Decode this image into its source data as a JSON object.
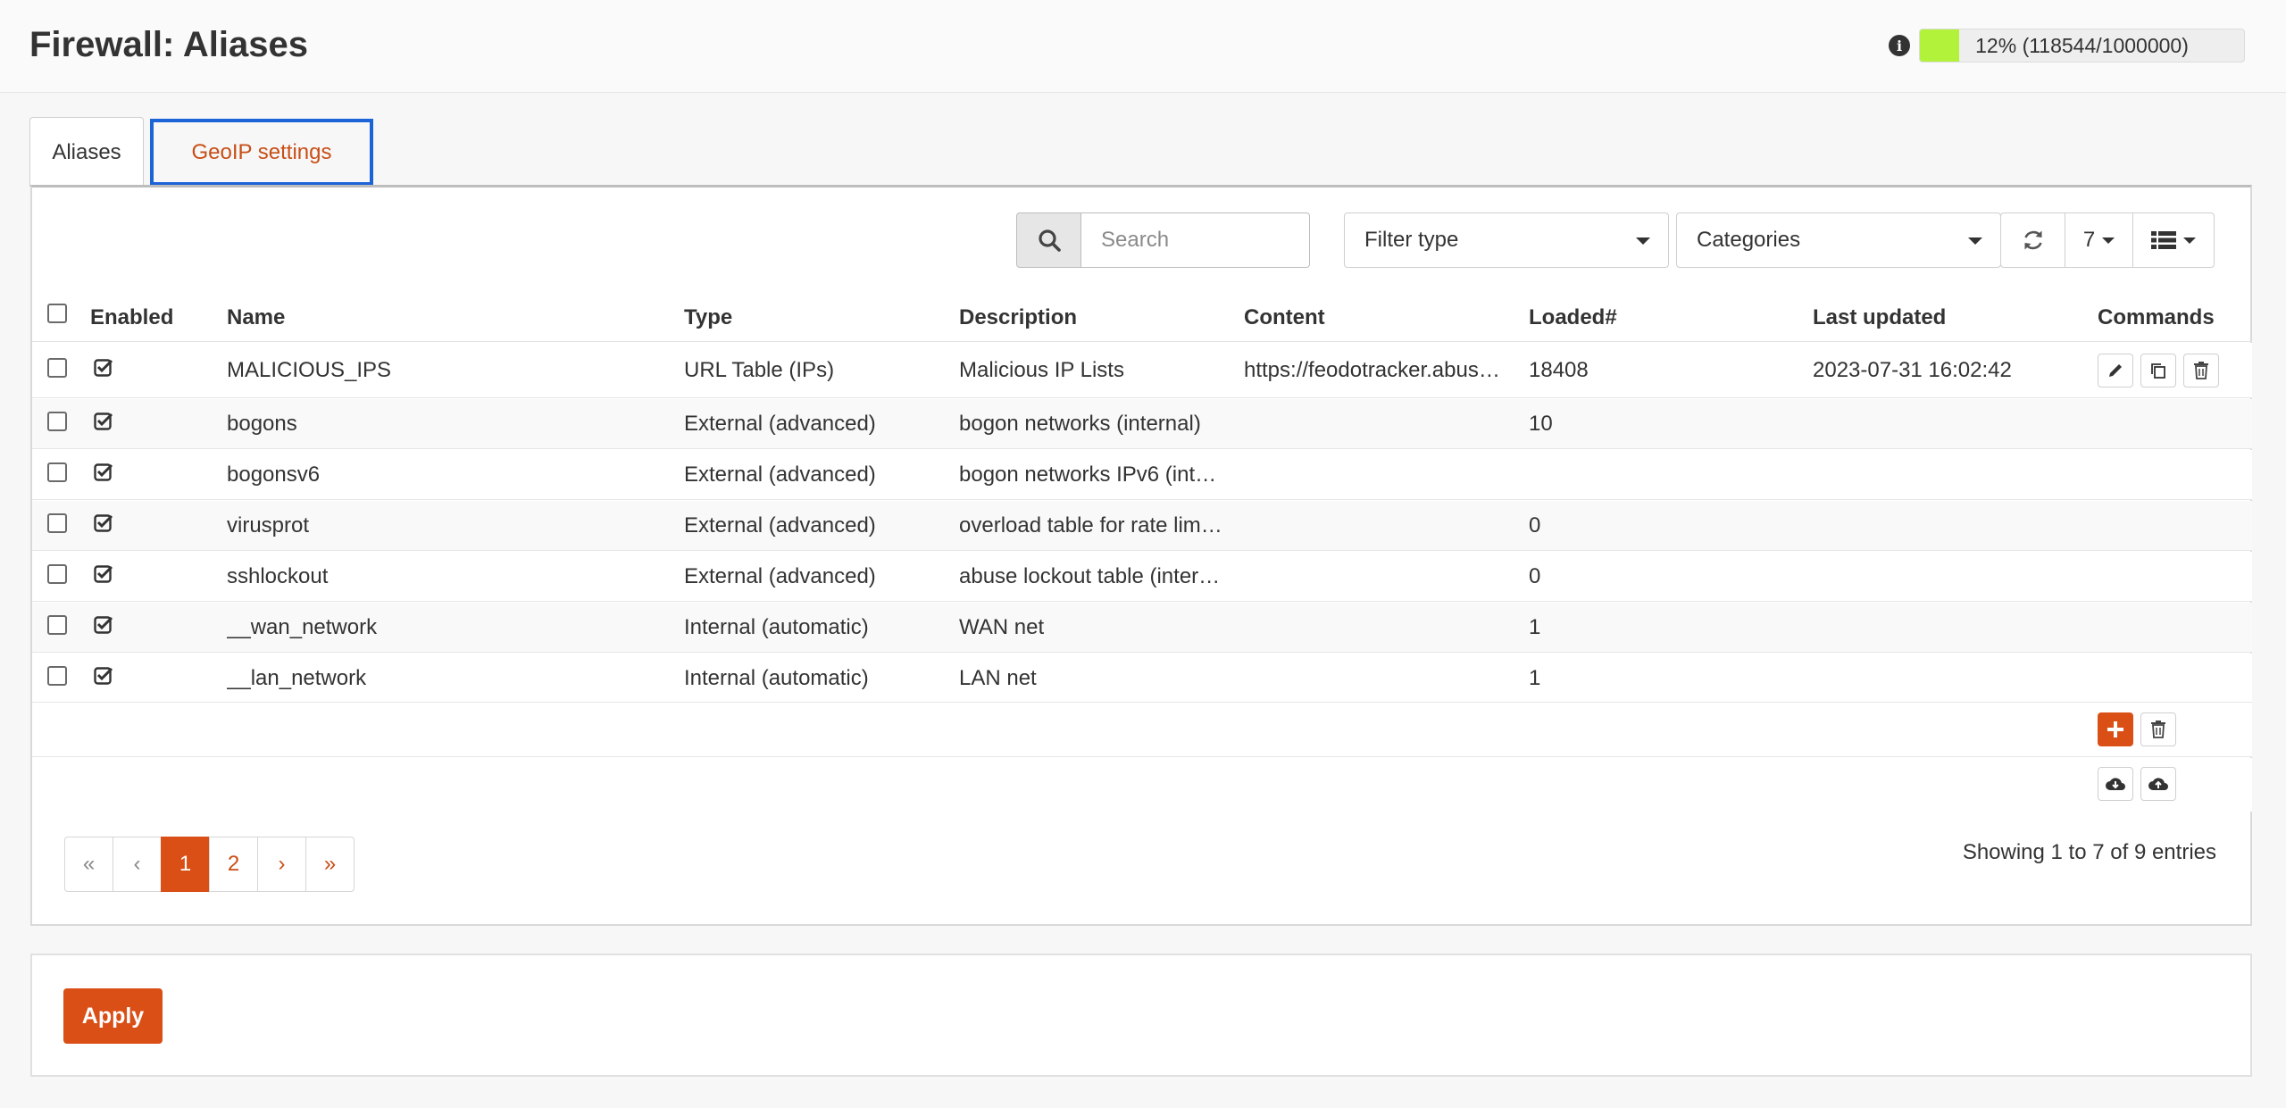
{
  "header": {
    "title": "Firewall: Aliases",
    "usage_text": "12% (118544/1000000)",
    "usage_fraction": 0.12,
    "usage_color": "#b2f23a"
  },
  "tabs": [
    {
      "label": "Aliases",
      "active": true
    },
    {
      "label": "GeoIP settings",
      "active": false
    }
  ],
  "toolbar": {
    "search_placeholder": "Search",
    "filter_type": "Filter type",
    "categories": "Categories",
    "row_count": "7"
  },
  "table": {
    "columns": [
      "Enabled",
      "Name",
      "Type",
      "Description",
      "Content",
      "Loaded#",
      "Last updated",
      "Commands"
    ],
    "rows": [
      {
        "name": "MALICIOUS_IPS",
        "type": "URL Table (IPs)",
        "description": "Malicious IP Lists",
        "content": "https://feodotracker.abus…",
        "loaded": "18408",
        "updated": "2023-07-31 16:02:42"
      },
      {
        "name": "bogons",
        "type": "External (advanced)",
        "description": "bogon networks (internal)",
        "content": "",
        "loaded": "10",
        "updated": ""
      },
      {
        "name": "bogonsv6",
        "type": "External (advanced)",
        "description": "bogon networks IPv6 (int…",
        "content": "",
        "loaded": "",
        "updated": ""
      },
      {
        "name": "virusprot",
        "type": "External (advanced)",
        "description": "overload table for rate lim…",
        "content": "",
        "loaded": "0",
        "updated": ""
      },
      {
        "name": "sshlockout",
        "type": "External (advanced)",
        "description": "abuse lockout table (inter…",
        "content": "",
        "loaded": "0",
        "updated": ""
      },
      {
        "name": "__wan_network",
        "type": "Internal (automatic)",
        "description": "WAN net",
        "content": "",
        "loaded": "1",
        "updated": ""
      },
      {
        "name": "__lan_network",
        "type": "Internal (automatic)",
        "description": "LAN net",
        "content": "",
        "loaded": "1",
        "updated": ""
      }
    ]
  },
  "pagination": {
    "first": "«",
    "prev": "‹",
    "pages": [
      "1",
      "2"
    ],
    "next": "›",
    "last": "»",
    "summary": "Showing 1 to 7 of 9 entries"
  },
  "apply_label": "Apply",
  "colors": {
    "accent": "#d94f16",
    "focus": "#1d63d8"
  }
}
